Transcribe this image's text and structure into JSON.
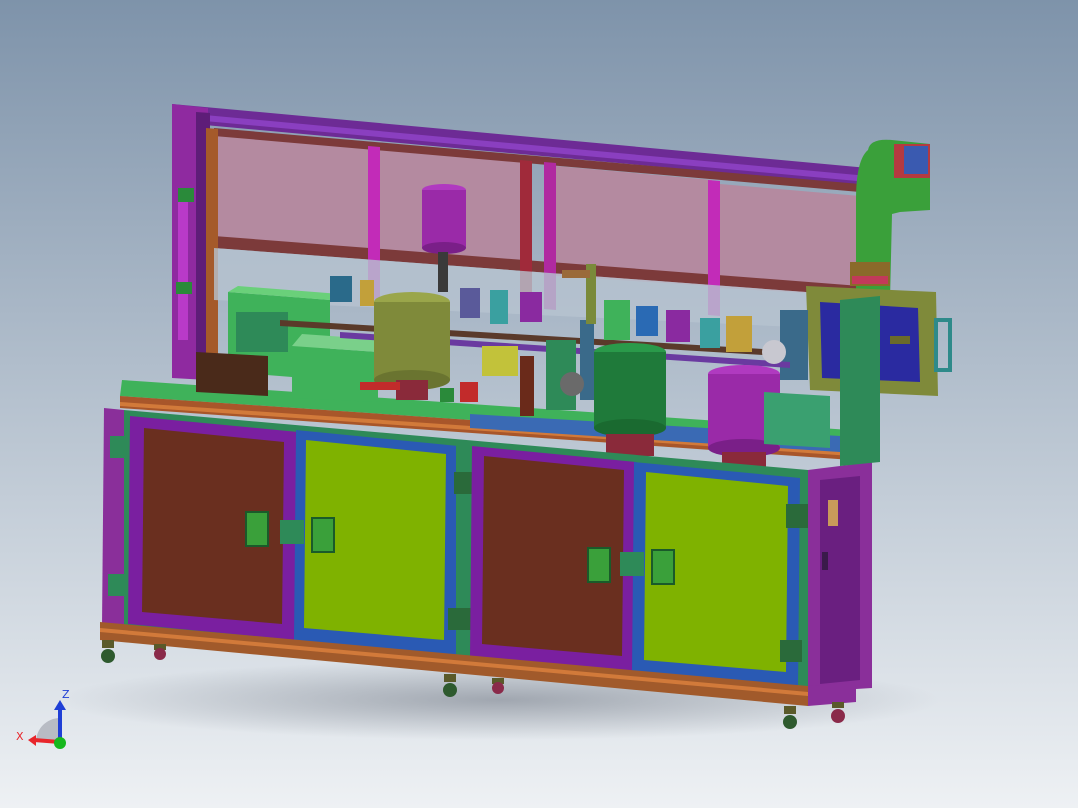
{
  "viewport": {
    "background_top": "#7e93aa",
    "background_bottom": "#eef1f4"
  },
  "triad": {
    "x_label": "X",
    "z_label": "Z",
    "x_color": "#e8262b",
    "z_color": "#1f3fd6",
    "origin_color": "#16b81d"
  },
  "model": {
    "description_icons": [
      "machine-frame",
      "cabinet-door",
      "motor",
      "feeder-bowl",
      "caster-wheel"
    ],
    "colors": {
      "frame": "#7a1fa0",
      "frame_dark": "#4a1a6e",
      "upright": "#b01aa8",
      "panel_top": "#b98ea2",
      "table": "#3fb25a",
      "door_brown": "#6a2f1f",
      "door_green": "#7fb200",
      "door_frame": "#2e8a58",
      "base_rail": "#a15a2b",
      "side_panel": "#8a2f9a",
      "feeder_olive": "#7f8a3a",
      "feeder_green": "#1f7a3a",
      "feeder_purple": "#9a2aa8",
      "motor_box": "#2a2aa0",
      "elbow_green": "#3fa83a"
    }
  }
}
